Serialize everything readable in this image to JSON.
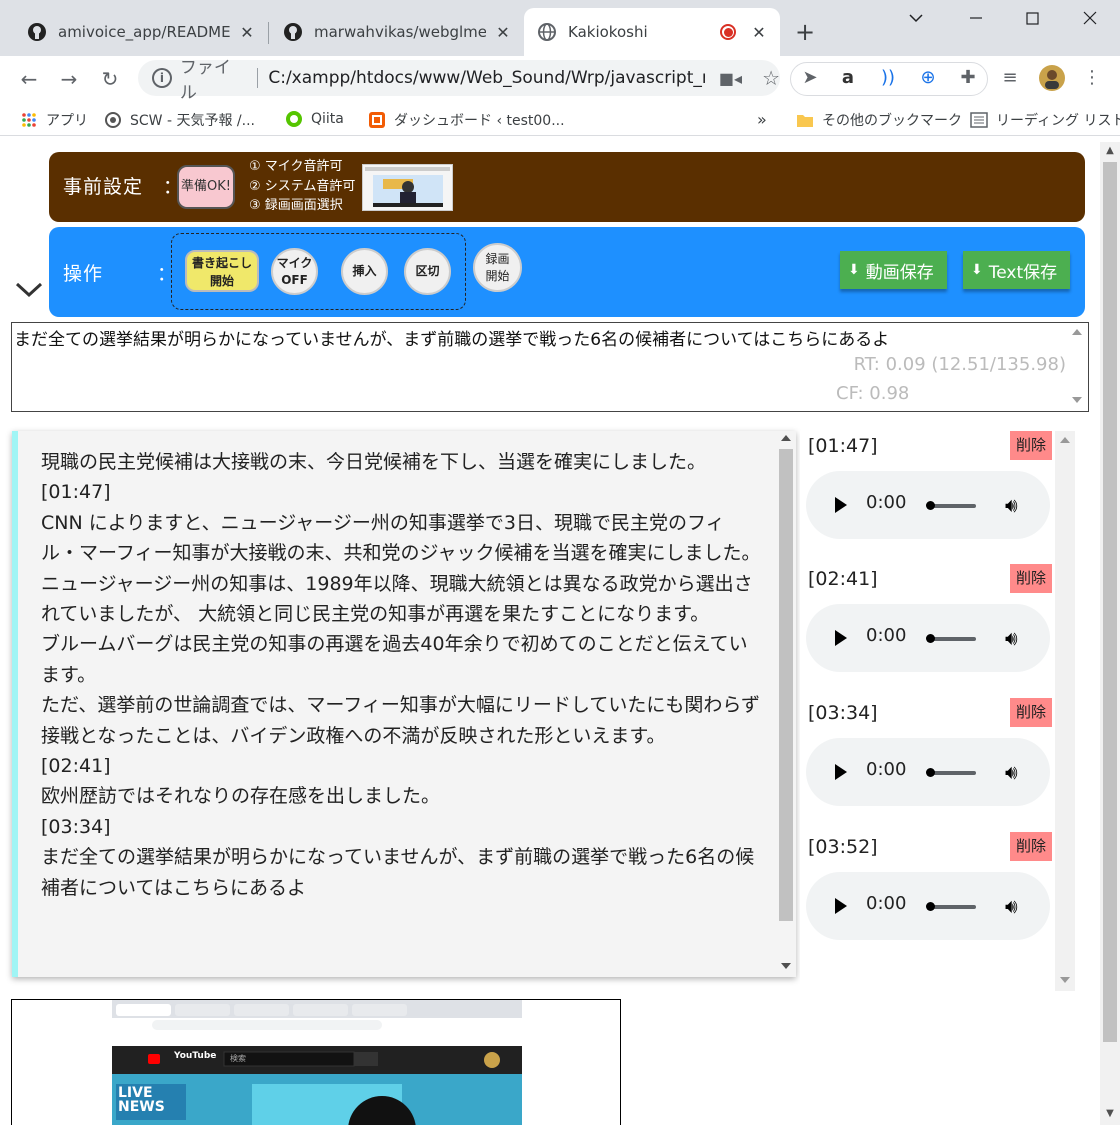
{
  "browser": {
    "tabs": [
      {
        "title": "amivoice_app/README.m",
        "icon": "github-icon"
      },
      {
        "title": "marwahvikas/webglmeeti",
        "icon": "github-icon"
      },
      {
        "title": "Kakiokoshi",
        "icon": "globe-icon",
        "active": true
      }
    ],
    "address": {
      "scheme": "ファイル",
      "url": "C:/xampp/htdocs/www/Web_Sound/Wrp/javascript_re..."
    },
    "bookmarks": [
      {
        "label": "アプリ",
        "icon": "apps-grid-icon"
      },
      {
        "label": "SCW - 天気予報 /...",
        "icon": "weather-icon"
      },
      {
        "label": "Qiita",
        "icon": "qiita-icon"
      },
      {
        "label": "ダッシュボード ‹ test00...",
        "icon": "dashboard-icon"
      },
      {
        "label": "その他のブックマーク",
        "icon": "folder-icon"
      },
      {
        "label": "リーディング リスト",
        "icon": "reading-list-icon"
      }
    ],
    "bookmarks_overflow": "»"
  },
  "prep": {
    "title": "事前設定　：",
    "ready_button": "準備OK!",
    "steps": [
      "① マイク音許可",
      "② システム音許可",
      "③ 録画画面選択"
    ]
  },
  "ops": {
    "title": "操作",
    "colon": "：",
    "transcribe_line1": "書き起こし",
    "transcribe_line2": "開始",
    "mic_line1": "マイク",
    "mic_line2": "OFF",
    "insert": "挿入",
    "split": "区切",
    "record_line1": "録画",
    "record_line2": "開始",
    "save_video": "動画保存",
    "save_text": "Text保存"
  },
  "live": {
    "text": "まだ全ての選挙結果が明らかになっていませんが、まず前職の選挙で戦った6名の候補者についてはこちらにあるよ",
    "rt": "RT: 0.09 (12.51/135.98)",
    "cf": "CF: 0.98"
  },
  "transcript": {
    "lines": [
      "現職の民主党候補は大接戦の末、今日党候補を下し、当選を確実にしました。",
      "[01:47]",
      "CNN によりますと、ニュージャージー州の知事選挙で3日、現職で民主党のフィル・マーフィー知事が大接戦の末、共和党のジャック候補を当選を確実にしました。",
      "ニュージャージー州の知事は、1989年以降、現職大統領とは異なる政党から選出されていましたが、 大統領と同じ民主党の知事が再選を果たすことになります。",
      "ブルームバーグは民主党の知事の再選を過去40年余りで初めてのことだと伝えています。",
      "ただ、選挙前の世論調査では、マーフィー知事が大幅にリードしていたにも関わらず接戦となったことは、バイデン政権への不満が反映された形といえます。",
      "[02:41]",
      "欧州歴訪ではそれなりの存在感を出しました。",
      "[03:34]",
      "まだ全ての選挙結果が明らかになっていませんが、まず前職の選挙で戦った6名の候補者についてはこちらにあるよ"
    ]
  },
  "audio": {
    "delete_label": "削除",
    "items": [
      {
        "timestamp": "[01:47]",
        "time": "0:00"
      },
      {
        "timestamp": "[02:41]",
        "time": "0:00"
      },
      {
        "timestamp": "[03:34]",
        "time": "0:00"
      },
      {
        "timestamp": "[03:52]",
        "time": "0:00"
      }
    ]
  },
  "preview": {
    "search_placeholder": "検索",
    "youtube_label": "YouTube",
    "overlay_text": "LIVE NEWS"
  },
  "colors": {
    "prep_bg": "#5a2f00",
    "ops_bg": "#1e90ff",
    "save_btn": "#4caf50",
    "delete_btn": "#ff8a8a",
    "transcript_accent": "#a0f5f5"
  }
}
